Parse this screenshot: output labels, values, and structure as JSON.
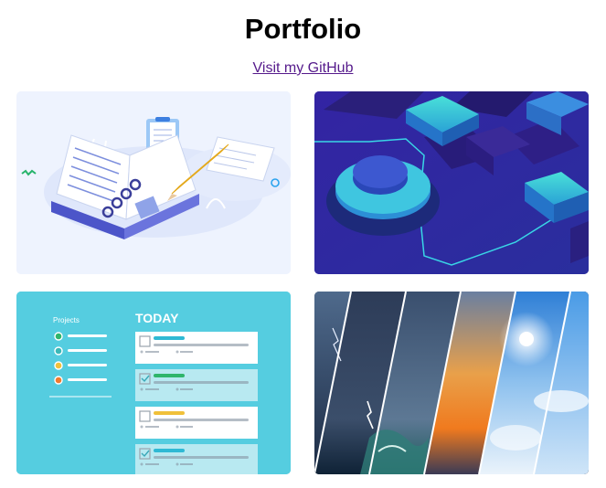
{
  "header": {
    "title": "Portfolio",
    "github_link": "Visit my GitHub"
  },
  "cards": [
    {
      "name": "notebook-illustration"
    },
    {
      "name": "isometric-blocks-illustration"
    },
    {
      "name": "todo-app-illustration",
      "sidebar_title": "Projects",
      "heading": "TODAY"
    },
    {
      "name": "weather-collage-photo"
    }
  ]
}
